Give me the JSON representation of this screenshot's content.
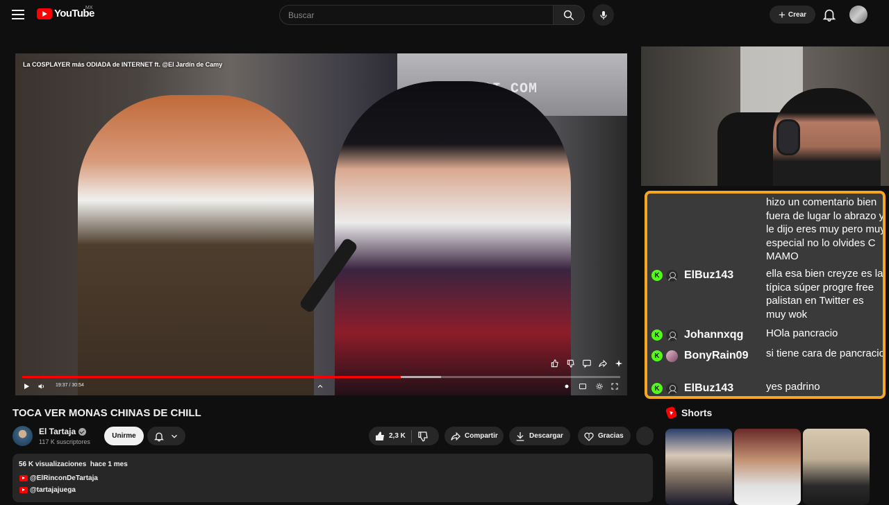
{
  "header": {
    "logo_text": "YouTube",
    "country_code": "MX",
    "search_placeholder": "Buscar",
    "create_label": "Crear"
  },
  "player": {
    "overlay_title": "La COSPLAYER más ODIADA de INTERNET ft. @El Jardín de Camy",
    "booth_text": ".AIRSOFTGI.COM",
    "time": "19:37 / 30:54",
    "progress_fraction": 0.633,
    "buffer_fraction": 0.7
  },
  "chat": {
    "messages": [
      {
        "user": "",
        "text": "hizo un comentario bien fuera de lugar lo abrazo y le dijo eres muy pero muy especial no lo olvides C MAMO",
        "avatar": "none"
      },
      {
        "user": "ElBuz143",
        "text": "ella esa bien creyze es la típica súper progre free palistan en Twitter es muy wok",
        "avatar": "default"
      },
      {
        "user": "Johannxqg",
        "text": "HOla pancracio",
        "avatar": "default"
      },
      {
        "user": "BonyRain09",
        "text": "si tiene cara de pancracio",
        "avatar": "photo"
      },
      {
        "user": "ElBuz143",
        "text": "yes padrino",
        "avatar": "default"
      }
    ],
    "badge_letter": "K",
    "border_color": "#f5a623",
    "badge_color": "#53fc18"
  },
  "video_info": {
    "title": "TOCA VER MONAS CHINAS DE CHILL",
    "channel_name": "El Tartaja",
    "subscribers": "117 K suscriptores",
    "join_label": "Unirme",
    "likes": "2,3 K",
    "share_label": "Compartir",
    "download_label": "Descargar",
    "thanks_label": "Gracias"
  },
  "description": {
    "views": "56 K visualizaciones",
    "date": "hace 1 mes",
    "links": [
      "@ElRinconDeTartaja",
      "@tartajajuega"
    ]
  },
  "shorts": {
    "heading": "Shorts",
    "count": 3
  }
}
